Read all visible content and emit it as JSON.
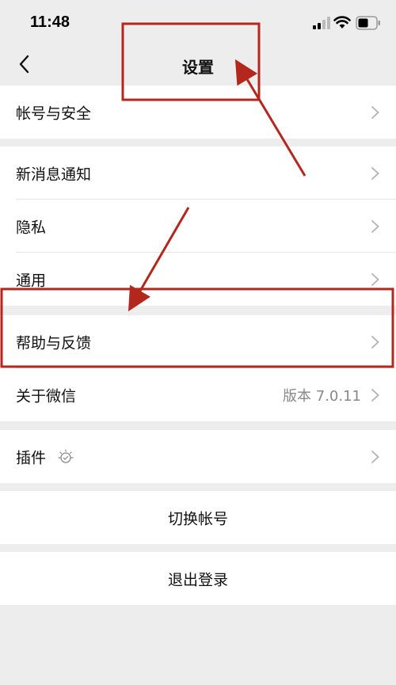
{
  "status_bar": {
    "time": "11:48"
  },
  "nav": {
    "title": "设置"
  },
  "settings": {
    "account_security": "帐号与安全",
    "new_message_notice": "新消息通知",
    "privacy": "隐私",
    "general": "通用",
    "help_feedback": "帮助与反馈",
    "about_wechat": "关于微信",
    "version": "版本 7.0.11",
    "plugins": "插件"
  },
  "actions": {
    "switch_account": "切换帐号",
    "logout": "退出登录"
  },
  "colors": {
    "background": "#ededed",
    "annotation_red": "#b3271d",
    "chevron": "#b2b2b2"
  }
}
